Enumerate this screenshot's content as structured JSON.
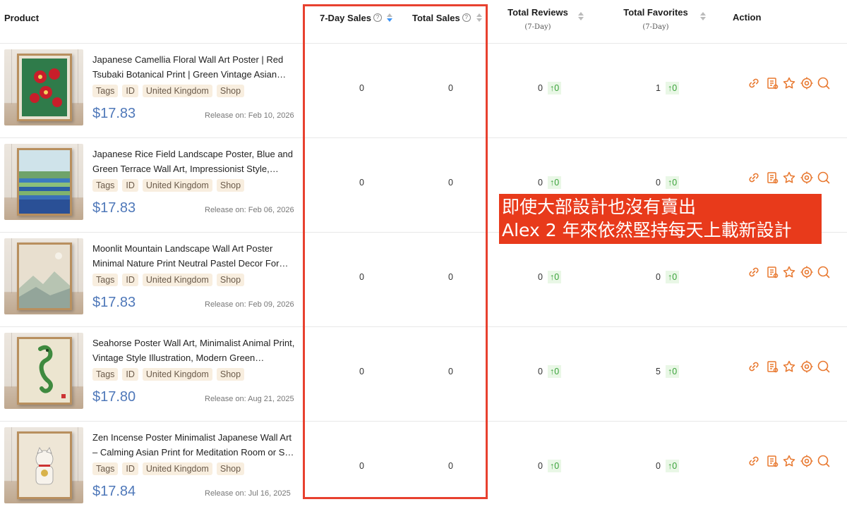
{
  "header": {
    "product": "Product",
    "seven_day_sales": "7-Day Sales",
    "total_sales": "Total Sales",
    "total_reviews": "Total Reviews",
    "total_reviews_sub": "(7-Day)",
    "total_favorites": "Total Favorites",
    "total_favorites_sub": "(7-Day)",
    "action": "Action",
    "help_glyph": "?"
  },
  "rows": [
    {
      "title": "Japanese Camellia Floral Wall Art Poster | Red Tsubaki Botanical Print | Green Vintage Asian…",
      "tags": [
        "Tags",
        "ID",
        "United Kingdom",
        "Shop"
      ],
      "price": "$17.83",
      "release": "Release on: Feb 10, 2026",
      "sales_7d": "0",
      "sales_total": "0",
      "reviews": "0",
      "reviews_delta": "↑0",
      "favorites": "1",
      "favorites_delta": "↑0"
    },
    {
      "title": "Japanese Rice Field Landscape Poster, Blue and Green Terrace Wall Art, Impressionist Style,…",
      "tags": [
        "Tags",
        "ID",
        "United Kingdom",
        "Shop"
      ],
      "price": "$17.83",
      "release": "Release on: Feb 06, 2026",
      "sales_7d": "0",
      "sales_total": "0",
      "reviews": "0",
      "reviews_delta": "↑0",
      "favorites": "0",
      "favorites_delta": "↑0"
    },
    {
      "title": "Moonlit Mountain Landscape Wall Art Poster Minimal Nature Print Neutral Pastel Decor For…",
      "tags": [
        "Tags",
        "ID",
        "United Kingdom",
        "Shop"
      ],
      "price": "$17.83",
      "release": "Release on: Feb 09, 2026",
      "sales_7d": "0",
      "sales_total": "0",
      "reviews": "0",
      "reviews_delta": "↑0",
      "favorites": "0",
      "favorites_delta": "↑0"
    },
    {
      "title": "Seahorse Poster Wall Art, Minimalist Animal Print, Vintage Style Illustration, Modern Green…",
      "tags": [
        "Tags",
        "ID",
        "United Kingdom",
        "Shop"
      ],
      "price": "$17.80",
      "release": "Release on: Aug 21, 2025",
      "sales_7d": "0",
      "sales_total": "0",
      "reviews": "0",
      "reviews_delta": "↑0",
      "favorites": "5",
      "favorites_delta": "↑0"
    },
    {
      "title": "Zen Incense Poster Minimalist Japanese Wall Art – Calming Asian Print for Meditation Room or S…",
      "tags": [
        "Tags",
        "ID",
        "United Kingdom",
        "Shop"
      ],
      "price": "$17.84",
      "release": "Release on: Jul 16, 2025",
      "sales_7d": "0",
      "sales_total": "0",
      "reviews": "0",
      "reviews_delta": "↑0",
      "favorites": "0",
      "favorites_delta": "↑0"
    }
  ],
  "overlay": {
    "line1": "即使大部設計也沒有賣出",
    "line2": "Alex 2 年來依然堅持每天上載新設計"
  },
  "colors": {
    "accent_action": "#e8782f",
    "price": "#4f78b9",
    "highlight_border": "#e8412f",
    "overlay_bg": "#e83a1b",
    "sort_active": "#3d94f6",
    "delta_green": "#3aa23a"
  },
  "icons": [
    "link-icon",
    "report-icon",
    "star-icon",
    "gear-icon",
    "search-icon"
  ]
}
